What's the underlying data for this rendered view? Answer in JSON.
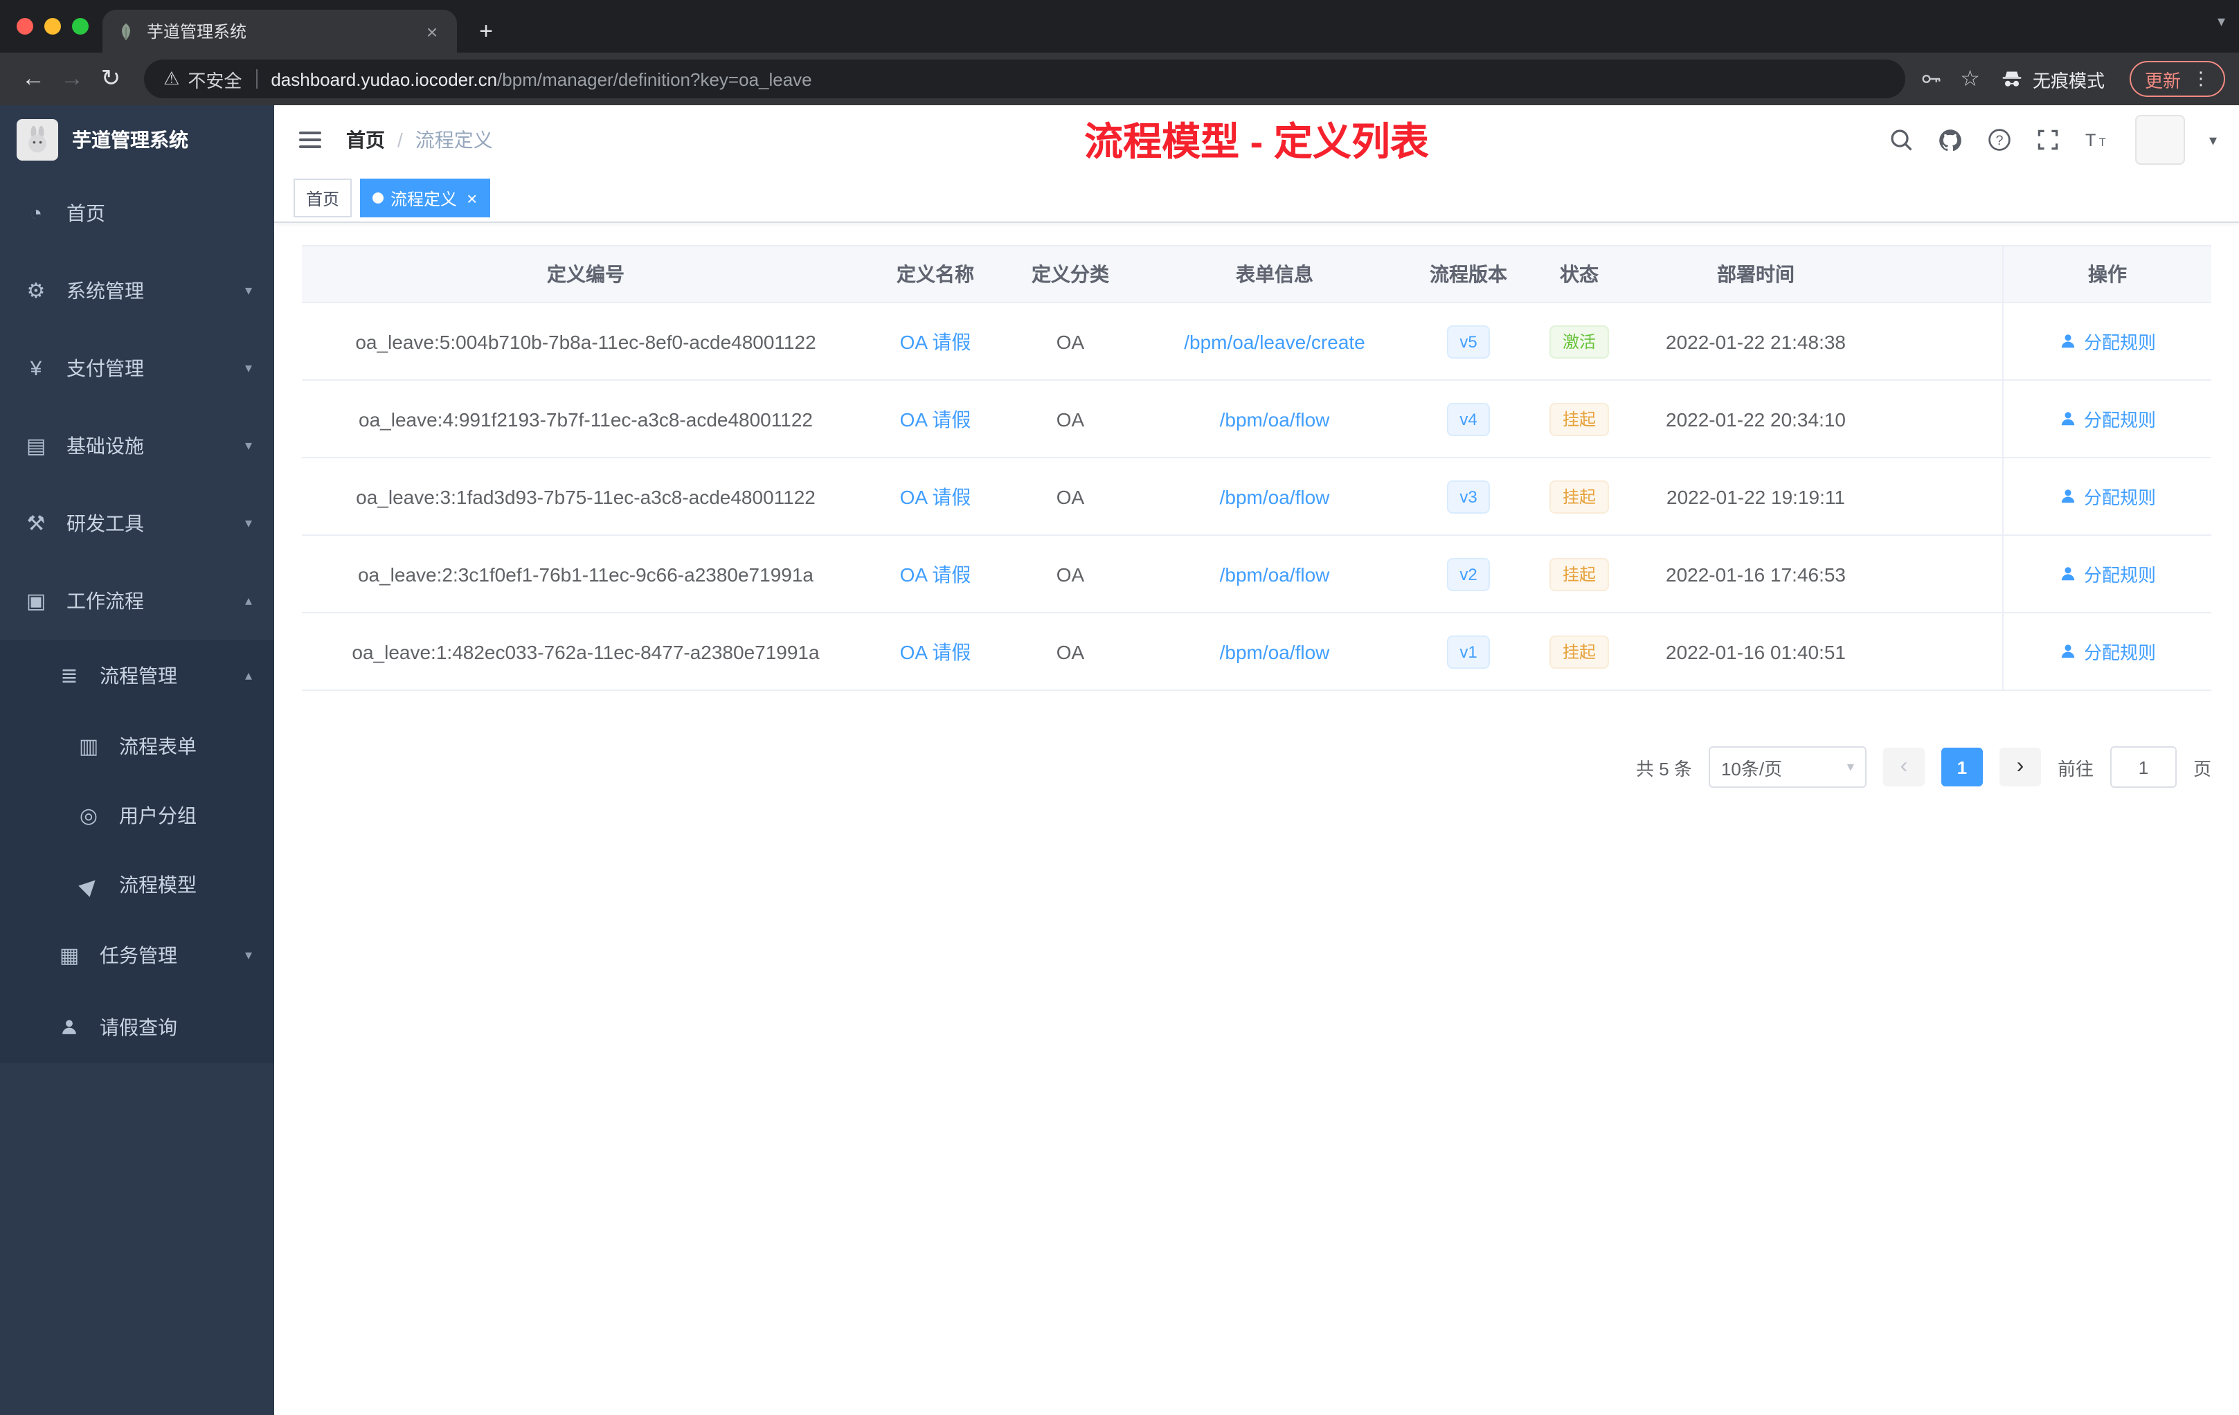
{
  "icons": {
    "back": "←",
    "forward": "→",
    "reload": "↻",
    "warning": "⚠",
    "star": "☆",
    "dots": "⋮",
    "plus": "+",
    "tab_close": "×",
    "tab_chevron": "▾",
    "dashboard": "◔",
    "gear": "⚙",
    "yen": "¥",
    "infra": "▤",
    "tools": "⚒",
    "workflow": "▣",
    "process_manage": "≣",
    "form": "▥",
    "user_group": "◎",
    "model": "▶",
    "task": "▦",
    "chevron_down": "▾",
    "chevron_up": "▴",
    "caret_down": "▾",
    "select_caret": "▾",
    "arrow_left": "‹",
    "arrow_right": "›",
    "tag_close": "×"
  },
  "browser": {
    "tab_title": "芋道管理系统",
    "security_label": "不安全",
    "url_host": "dashboard.yudao.iocoder.cn",
    "url_path": "/bpm/manager/definition?key=oa_leave",
    "incognito_label": "无痕模式",
    "update_label": "更新"
  },
  "sidebar": {
    "title": "芋道管理系统",
    "items": [
      {
        "label": "首页"
      },
      {
        "label": "系统管理"
      },
      {
        "label": "支付管理"
      },
      {
        "label": "基础设施"
      },
      {
        "label": "研发工具"
      },
      {
        "label": "工作流程"
      },
      {
        "label": "流程管理"
      },
      {
        "label": "流程表单"
      },
      {
        "label": "用户分组"
      },
      {
        "label": "流程模型"
      },
      {
        "label": "任务管理"
      },
      {
        "label": "请假查询"
      }
    ]
  },
  "header": {
    "breadcrumb_home": "首页",
    "breadcrumb_sep": "/",
    "breadcrumb_current": "流程定义",
    "annotation": "流程模型 - 定义列表"
  },
  "tags": {
    "home": "首页",
    "active": "流程定义"
  },
  "table": {
    "columns": [
      "定义编号",
      "定义名称",
      "定义分类",
      "表单信息",
      "流程版本",
      "状态",
      "部署时间",
      "操作"
    ],
    "rows": [
      {
        "id": "oa_leave:5:004b710b-7b8a-11ec-8ef0-acde48001122",
        "name": "OA 请假",
        "category": "OA",
        "form": "/bpm/oa/leave/create",
        "version": "v5",
        "status": "激活",
        "time": "2022-01-22 21:48:38",
        "action": "分配规则"
      },
      {
        "id": "oa_leave:4:991f2193-7b7f-11ec-a3c8-acde48001122",
        "name": "OA 请假",
        "category": "OA",
        "form": "/bpm/oa/flow",
        "version": "v4",
        "status": "挂起",
        "time": "2022-01-22 20:34:10",
        "action": "分配规则"
      },
      {
        "id": "oa_leave:3:1fad3d93-7b75-11ec-a3c8-acde48001122",
        "name": "OA 请假",
        "category": "OA",
        "form": "/bpm/oa/flow",
        "version": "v3",
        "status": "挂起",
        "time": "2022-01-22 19:19:11",
        "action": "分配规则"
      },
      {
        "id": "oa_leave:2:3c1f0ef1-76b1-11ec-9c66-a2380e71991a",
        "name": "OA 请假",
        "category": "OA",
        "form": "/bpm/oa/flow",
        "version": "v2",
        "status": "挂起",
        "time": "2022-01-16 17:46:53",
        "action": "分配规则"
      },
      {
        "id": "oa_leave:1:482ec033-762a-11ec-8477-a2380e71991a",
        "name": "OA 请假",
        "category": "OA",
        "form": "/bpm/oa/flow",
        "version": "v1",
        "status": "挂起",
        "time": "2022-01-16 01:40:51",
        "action": "分配规则"
      }
    ]
  },
  "pagination": {
    "total": "共 5 条",
    "page_size": "10条/页",
    "current": "1",
    "goto_label": "前往",
    "goto_value": "1",
    "page_unit": "页"
  }
}
